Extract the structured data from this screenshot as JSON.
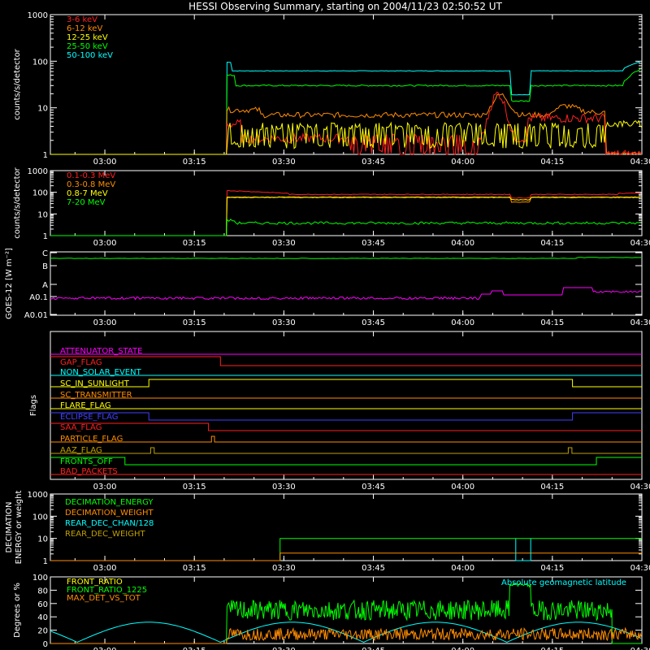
{
  "title": "HESSI Observing Summary, starting on 2004/11/23 02:50:52 UT",
  "x_ticks": [
    "03:00",
    "03:15",
    "03:30",
    "03:45",
    "04:00",
    "04:15",
    "04:30"
  ],
  "colors": {
    "red": "#ff2020",
    "orange": "#ff8c00",
    "yellow": "#ffff00",
    "green": "#00ff00",
    "cyan": "#00ffff",
    "magenta": "#ff00ff",
    "blue": "#4040ff",
    "olive": "#c0a000"
  },
  "chart_data": [
    {
      "id": "p1",
      "type": "line",
      "ylabel": "counts/s/detector",
      "ylim": [
        1,
        1000
      ],
      "y_ticks": [
        "1",
        "10",
        "100",
        "1000"
      ],
      "series": [
        {
          "name": "3-6 keV",
          "color": "#ff2020"
        },
        {
          "name": "6-12 keV",
          "color": "#ff8c00"
        },
        {
          "name": "12-25 keV",
          "color": "#ffff00"
        },
        {
          "name": "25-50 keV",
          "color": "#00ff00"
        },
        {
          "name": "50-100 keV",
          "color": "#00ffff"
        }
      ]
    },
    {
      "id": "p2",
      "type": "line",
      "ylabel": "counts/s/detector",
      "ylim": [
        1,
        1000
      ],
      "y_ticks": [
        "1",
        "10",
        "100",
        "1000"
      ],
      "series": [
        {
          "name": "0.1-0.3 MeV",
          "color": "#ff2020"
        },
        {
          "name": "0.3-0.8 MeV",
          "color": "#ff8c00"
        },
        {
          "name": "0.8-7 MeV",
          "color": "#ffff00"
        },
        {
          "name": "7-20 MeV",
          "color": "#00ff00"
        }
      ]
    },
    {
      "id": "p3",
      "type": "line",
      "ylabel": "GOES-12 [W m⁻²]",
      "y_ticks": [
        "A0.01",
        "A0.1",
        "A",
        "B",
        "C"
      ]
    },
    {
      "id": "p4",
      "type": "line",
      "ylabel": "Flags",
      "flags": [
        {
          "name": "ATTENUATOR_STATE",
          "color": "#ff00ff"
        },
        {
          "name": "GAP_FLAG",
          "color": "#ff2020"
        },
        {
          "name": "NON_SOLAR_EVENT",
          "color": "#00ffff"
        },
        {
          "name": "SC_IN_SUNLIGHT",
          "color": "#ffff00"
        },
        {
          "name": "SC_TRANSMITTER",
          "color": "#ff8c00"
        },
        {
          "name": "FLARE_FLAG",
          "color": "#ffff00"
        },
        {
          "name": "ECLIPSE_FLAG",
          "color": "#4040ff"
        },
        {
          "name": "SAA_FLAG",
          "color": "#ff2020"
        },
        {
          "name": "PARTICLE_FLAG",
          "color": "#ff8c00"
        },
        {
          "name": "AAZ_FLAG",
          "color": "#c0a000"
        },
        {
          "name": "FRONTS_OFF",
          "color": "#00ff00"
        },
        {
          "name": "BAD_PACKETS",
          "color": "#ff2020"
        }
      ]
    },
    {
      "id": "p5",
      "type": "line",
      "ylabel": "DECIMATION ENERGY or weight",
      "ylim": [
        1,
        1000
      ],
      "y_ticks": [
        "1",
        "10",
        "100",
        "1000"
      ],
      "series": [
        {
          "name": "DECIMATION_ENERGY",
          "color": "#00ff00"
        },
        {
          "name": "DECIMATION_WEIGHT",
          "color": "#ff8c00"
        },
        {
          "name": "REAR_DEC_CHAN/128",
          "color": "#00ffff"
        },
        {
          "name": "REAR_DEC_WEIGHT",
          "color": "#c0a000"
        }
      ]
    },
    {
      "id": "p6",
      "type": "line",
      "ylabel": "Degrees or %",
      "ylim": [
        0,
        100
      ],
      "y_ticks": [
        "0",
        "20",
        "40",
        "60",
        "80",
        "100"
      ],
      "series": [
        {
          "name": "FRONT_RATIO",
          "color": "#ffff00"
        },
        {
          "name": "FRONT_RATIO_1225",
          "color": "#00ff00"
        },
        {
          "name": "MAX_DET_VS_TOT",
          "color": "#ff8c00"
        },
        {
          "name": "Absolute geomagnetic latitude",
          "color": "#00ffff"
        }
      ]
    }
  ]
}
